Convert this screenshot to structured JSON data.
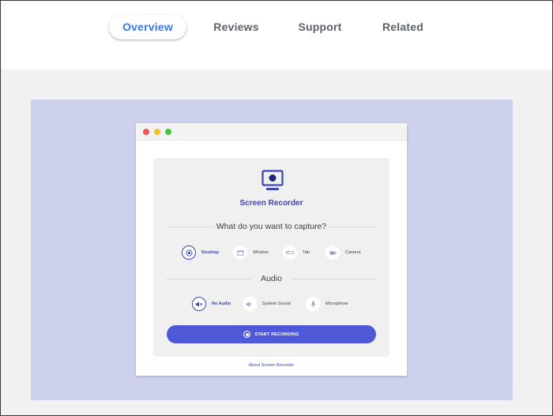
{
  "tabs": [
    {
      "label": "Overview",
      "active": true
    },
    {
      "label": "Reviews",
      "active": false
    },
    {
      "label": "Support",
      "active": false
    },
    {
      "label": "Related",
      "active": false
    }
  ],
  "colors": {
    "accent": "#3b78e7",
    "hero_bg": "#cdd1ec",
    "app_blue": "#3946b8",
    "button_bg": "#4f59d8",
    "page_bg": "#f1f1f1"
  },
  "app": {
    "icon": "monitor-icon",
    "title": "Screen Recorder",
    "capture_question": "What do you want to capture?",
    "capture_options": [
      {
        "label": "Desktop",
        "icon": "desktop-icon",
        "selected": true
      },
      {
        "label": "Window",
        "icon": "window-icon",
        "selected": false
      },
      {
        "label": "Tab",
        "icon": "tab-icon",
        "selected": false
      },
      {
        "label": "Camera",
        "icon": "camera-icon",
        "selected": false
      }
    ],
    "audio_heading": "Audio",
    "audio_options": [
      {
        "label": "No Audio",
        "icon": "mute-icon",
        "selected": true
      },
      {
        "label": "System Sound",
        "icon": "speaker-icon",
        "selected": false
      },
      {
        "label": "Microphone",
        "icon": "microphone-icon",
        "selected": false
      }
    ],
    "start_button": "START RECORDING",
    "about_link": "About Screen Recorder"
  }
}
